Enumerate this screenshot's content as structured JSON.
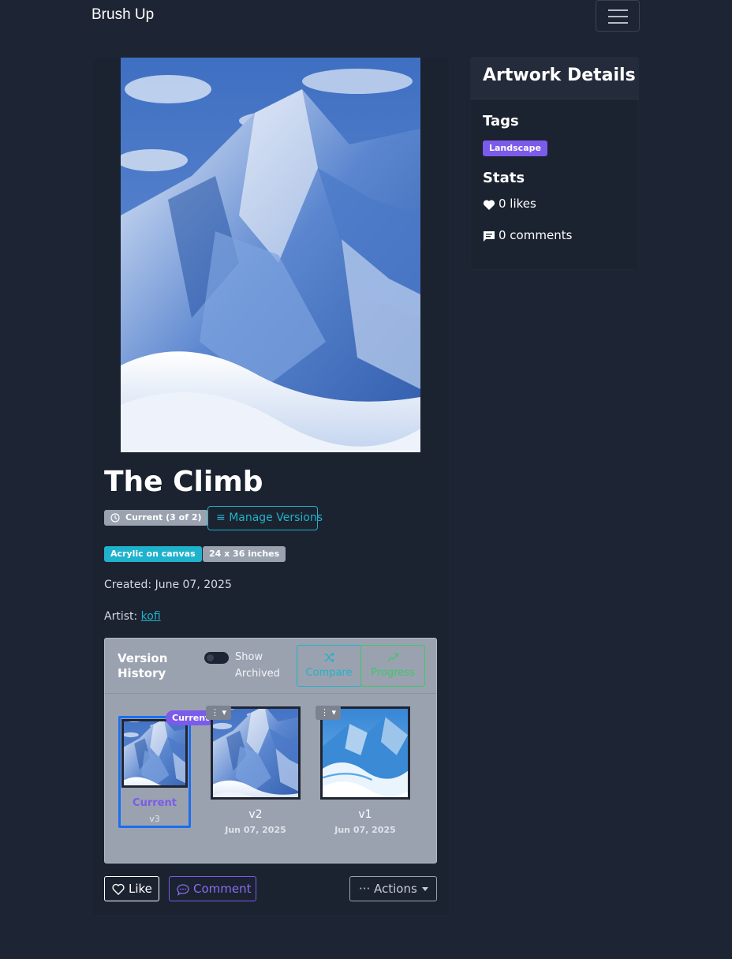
{
  "navbar": {
    "brand": "Brush Up"
  },
  "artwork": {
    "title": "The Climb",
    "version_badge": "Current (3 of 2)",
    "manage_versions_label": "Manage Versions",
    "medium": "Acrylic on canvas",
    "size": "24 x 36 inches",
    "created": "Created: June 07, 2025",
    "artist_label": "Artist:",
    "artist_name": "kofi"
  },
  "version_history": {
    "title": "Version History",
    "show_archived_label": "Show Archived",
    "show_archived_on": false,
    "compare_label": "Compare",
    "progress_label": "Progress",
    "versions": [
      {
        "badge": "Current",
        "name": "Current",
        "version": "v3"
      },
      {
        "name": "v2",
        "date": "Jun 07, 2025"
      },
      {
        "name": "v1",
        "date": "Jun 07, 2025"
      }
    ]
  },
  "actions": {
    "like_label": "Like",
    "comment_label": "Comment",
    "more_label": "Actions"
  },
  "sidebar": {
    "title": "Artwork Details",
    "tags_heading": "Tags",
    "tags": [
      "Landscape"
    ],
    "stats_heading": "Stats",
    "likes_text": "0 likes",
    "comments_text": "0 comments"
  },
  "colors": {
    "background": "#1d2433",
    "accent_purple": "#7b5bea",
    "info_cyan": "#20b2c8",
    "success_green": "#3fc66a",
    "selected_blue": "#1a6ef0"
  }
}
